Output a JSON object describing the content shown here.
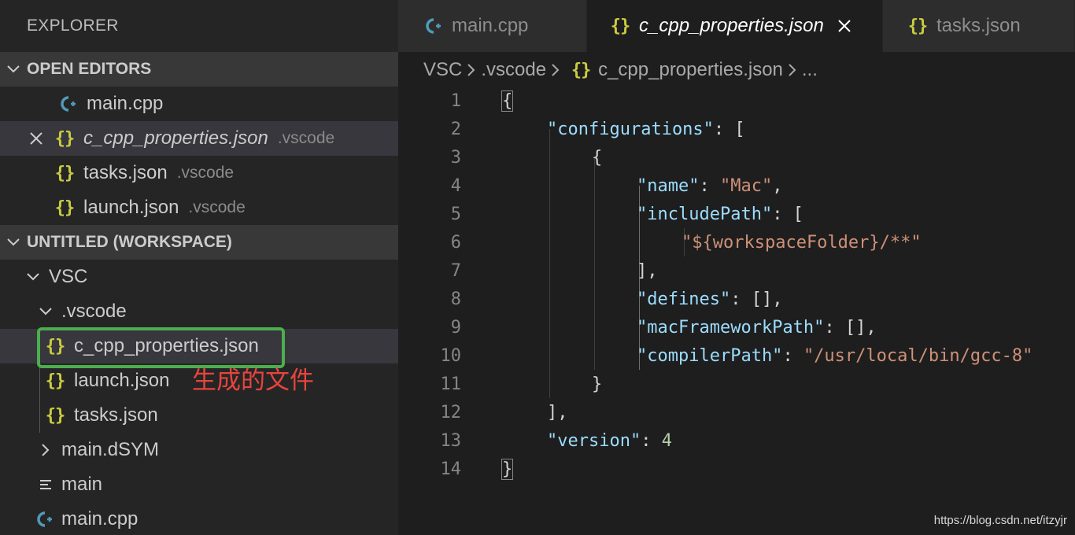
{
  "sidebar": {
    "title": "EXPLORER",
    "open_editors": {
      "header": "OPEN EDITORS",
      "items": [
        {
          "name": "main.cpp",
          "desc": ""
        },
        {
          "name": "c_cpp_properties.json",
          "desc": ".vscode"
        },
        {
          "name": "tasks.json",
          "desc": ".vscode"
        },
        {
          "name": "launch.json",
          "desc": ".vscode"
        }
      ]
    },
    "workspace": {
      "header": "UNTITLED (WORKSPACE)",
      "tree": {
        "root": "VSC",
        "vscode_folder": ".vscode",
        "vscode_files": [
          "c_cpp_properties.json",
          "launch.json",
          "tasks.json"
        ],
        "dsym_folder": "main.dSYM",
        "main_file": "main",
        "main_cpp": "main.cpp"
      }
    },
    "annotation": "生成的文件"
  },
  "tabs": [
    {
      "label": "main.cpp",
      "icon": "cpp-icon"
    },
    {
      "label": "c_cpp_properties.json",
      "icon": "json-icon"
    },
    {
      "label": "tasks.json",
      "icon": "json-icon"
    }
  ],
  "breadcrumb": {
    "items": [
      "VSC",
      ".vscode",
      "c_cpp_properties.json"
    ],
    "ellipsis": "..."
  },
  "editor": {
    "line_numbers": [
      "1",
      "2",
      "3",
      "4",
      "5",
      "6",
      "7",
      "8",
      "9",
      "10",
      "11",
      "12",
      "13",
      "14"
    ],
    "json": {
      "key_configurations": "\"configurations\"",
      "key_name": "\"name\"",
      "val_name": "\"Mac\"",
      "key_includePath": "\"includePath\"",
      "val_includePath": "\"${workspaceFolder}/**\"",
      "key_defines": "\"defines\"",
      "key_macFrameworkPath": "\"macFrameworkPath\"",
      "key_compilerPath": "\"compilerPath\"",
      "val_compilerPath": "\"/usr/local/bin/gcc-8\"",
      "key_version": "\"version\"",
      "val_version": "4"
    }
  },
  "watermark": "https://blog.csdn.net/itzyjr",
  "colors": {
    "json_icon": "#cbcb41",
    "cpp_icon": "#519aba",
    "highlight_box": "#4cae4c",
    "annotation": "#e8453c",
    "json_key": "#9cdcfe",
    "json_string": "#ce9178",
    "json_number": "#b5cea8"
  }
}
